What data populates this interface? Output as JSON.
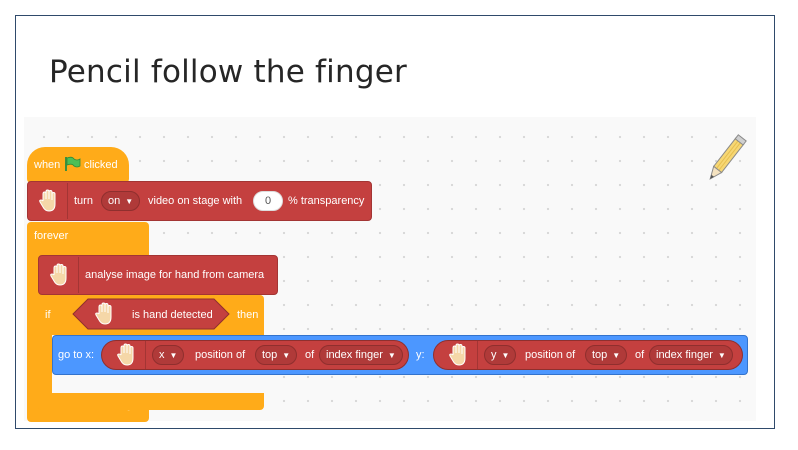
{
  "slide": {
    "title": "Pencil follow the finger"
  },
  "script": {
    "hat": {
      "when": "when",
      "clicked": "clicked"
    },
    "video": {
      "turn": "turn",
      "state": "on",
      "text": "video on stage with",
      "transparency": "0",
      "suffix": "% transparency"
    },
    "forever": {
      "label": "forever"
    },
    "analyse": {
      "label": "analyse image for hand from camera"
    },
    "if_block": {
      "if": "if",
      "condition": "is hand detected",
      "then": "then"
    },
    "goto": {
      "label_x": "go to x:",
      "label_y": "y:",
      "x_reporter": {
        "axis": "x",
        "position_of": "position of",
        "part": "top",
        "of": "of",
        "finger": "index finger"
      },
      "y_reporter": {
        "axis": "y",
        "position_of": "position of",
        "part": "top",
        "of": "of",
        "finger": "index finger"
      }
    }
  },
  "colors": {
    "events": "#ffab19",
    "control": "#ffab19",
    "extension": "#c4403f",
    "motion": "#4c97ff",
    "flag": "#4cbf56"
  },
  "icons": [
    "green-flag-icon",
    "hand-icon",
    "dropdown-caret-icon",
    "loop-arrow-icon",
    "pencil-icon"
  ]
}
